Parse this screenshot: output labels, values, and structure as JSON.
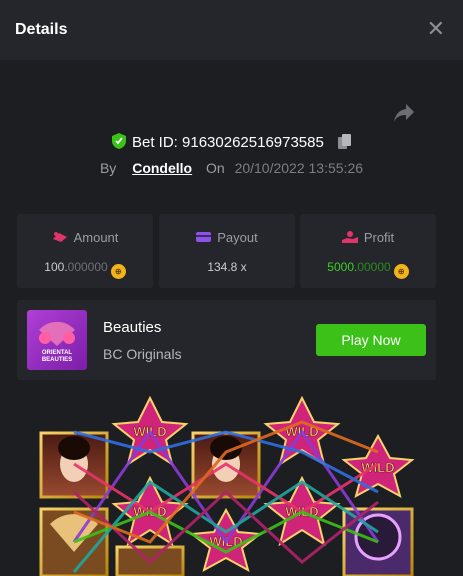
{
  "header": {
    "title": "Details",
    "close_glyph": "✕"
  },
  "bet": {
    "label": "Bet ID:",
    "id": "91630262516973585"
  },
  "byline": {
    "by": "By",
    "user": "Condello",
    "on": "On",
    "date": "20/10/2022 13:55:26"
  },
  "stats": {
    "amount": {
      "label": "Amount",
      "value_main": "100.",
      "value_dim": "000000"
    },
    "payout": {
      "label": "Payout",
      "value": "134.8 x"
    },
    "profit": {
      "label": "Profit",
      "value_main": "5000.",
      "value_dim": "00000"
    }
  },
  "game": {
    "thumb_text": "ORIENTAL BEAUTIES",
    "name": "Beauties",
    "provider": "BC Originals",
    "play_label": "Play Now"
  },
  "slot": {
    "wild_text": "WILD"
  },
  "icons": [
    "close-icon",
    "share-icon",
    "shield-icon",
    "copy-icon",
    "amount-icon",
    "payout-icon",
    "profit-icon",
    "coin-icon"
  ],
  "colors": {
    "accent_green": "#3bc117",
    "profit_green": "#3ad022",
    "coin": "#f2b31b",
    "wild_pink": "#d0247a"
  }
}
